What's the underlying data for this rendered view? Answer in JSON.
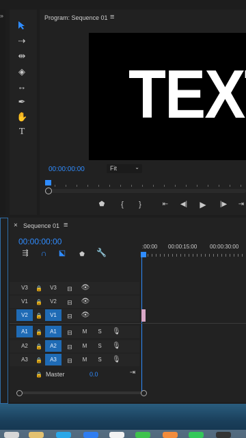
{
  "program_monitor": {
    "title": "Program: Sequence 01",
    "menu_icon": "hamburger-icon",
    "preview_text": "TEXT",
    "timecode": "00:00:00:00",
    "zoom": "Fit"
  },
  "tools": [
    "selection-tool-icon",
    "track-select-tool-icon",
    "ripple-edit-tool-icon",
    "razor-tool-icon",
    "slip-tool-icon",
    "pen-tool-icon",
    "hand-tool-icon",
    "type-tool-icon"
  ],
  "transport": [
    "marker-icon",
    "in-point-icon",
    "out-point-icon",
    "go-to-in-icon",
    "step-back-icon",
    "play-icon",
    "step-forward-icon",
    "go-to-out-icon"
  ],
  "timeline": {
    "close": "×",
    "tab_title": "Sequence 01",
    "timecode": "00:00:00:00",
    "ruler_labels": [
      ":00:00",
      "00:00:15:00",
      "00:00:30:00"
    ],
    "video_tracks": [
      {
        "target": "V3",
        "label": "V3"
      },
      {
        "target": "V1",
        "label": "V2"
      },
      {
        "target": "V2",
        "label": "V1"
      }
    ],
    "audio_tracks": [
      {
        "target": "A1",
        "label": "A1",
        "m": "M",
        "s": "S"
      },
      {
        "target": "A2",
        "label": "A2",
        "m": "M",
        "s": "S"
      },
      {
        "target": "A3",
        "label": "A3",
        "m": "M",
        "s": "S"
      }
    ],
    "master_label": "Master",
    "master_value": "0.0"
  }
}
